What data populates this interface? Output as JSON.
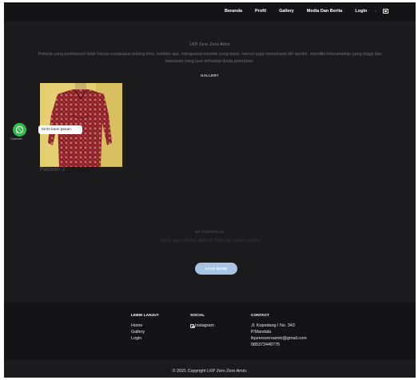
{
  "nav": {
    "items": [
      "Beranda",
      "Profil",
      "Gallery",
      "Media Dan Berita",
      "Login"
    ],
    "separator": "-"
  },
  "hero": {
    "brand": "LKP Zero Zero Amin",
    "description": "Pekerja yang profesional tidak hanya menguasai bidang ilmu, bahkan ajar, menguasai metode yang tepat, namun juga memahami diri sendiri, memiliki keterampilan yang tinggi dan wawasan yang luas terhadap dunia pekerjaan."
  },
  "gallery": {
    "label": "GALLERY",
    "items": [
      {
        "caption": "Pakaian 2"
      }
    ]
  },
  "whatsapp": {
    "caption": "Customer",
    "bubble": "Kirim kami pesan",
    "color": "#2fbd4a"
  },
  "portfolio": {
    "label": "MY PORTFOLIO",
    "subtitle": "Here you will be able to find my latest works",
    "button": "LOAD MORE",
    "button_color": "#a8c4e4"
  },
  "footer": {
    "col1": {
      "title": "LEBIH LANJUT",
      "links": [
        "Home",
        "Gallery",
        "Login"
      ]
    },
    "col2": {
      "title": "SOCIAL",
      "links": [
        "Instagram"
      ]
    },
    "col3": {
      "title": "CONTACT",
      "lines": [
        "Jl. Kopodang I No. 343",
        "P.Mandala",
        "lkpzerozeroamin@gmail.com",
        "085373448775"
      ]
    },
    "copyright": "© 2021 Copyright LKP Zero Zero Amin."
  }
}
